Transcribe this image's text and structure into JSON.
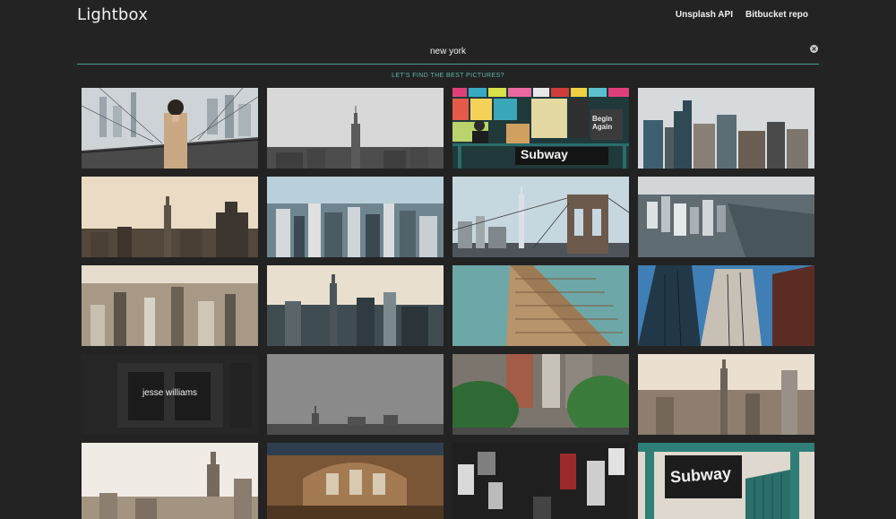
{
  "header": {
    "brand": "Lightbox",
    "nav": [
      "Unsplash API",
      "Bitbucket repo"
    ]
  },
  "search": {
    "value": "new york",
    "tagline": "LET'S FIND THE BEST PICTURES?"
  },
  "results": {
    "tiles": [
      {
        "subject": "woman on brooklyn bridge"
      },
      {
        "subject": "empire state skyline in fog"
      },
      {
        "subject": "subway sign and posters",
        "sign": "Subway",
        "poster": "Begin Again"
      },
      {
        "subject": "midtown skyscrapers"
      },
      {
        "subject": "empire state at sunset"
      },
      {
        "subject": "aerial manhattan"
      },
      {
        "subject": "brooklyn bridge and one world trade"
      },
      {
        "subject": "lower manhattan aerial"
      },
      {
        "subject": "manhattan rooftops"
      },
      {
        "subject": "skyline with empire state"
      },
      {
        "subject": "flatiron building"
      },
      {
        "subject": "looking up at towers"
      },
      {
        "subject": "dark storefront",
        "caption": "jesse williams"
      },
      {
        "subject": "grey foggy skyline"
      },
      {
        "subject": "street with trees"
      },
      {
        "subject": "hazy skyline"
      },
      {
        "subject": "empire state from the west"
      },
      {
        "subject": "grand central terminal"
      },
      {
        "subject": "times square at night"
      },
      {
        "subject": "subway entrance",
        "sign": "Subway"
      }
    ]
  },
  "colors": {
    "background": "#232323",
    "accent": "#5fb6a8",
    "divider": "#4a9e90"
  }
}
